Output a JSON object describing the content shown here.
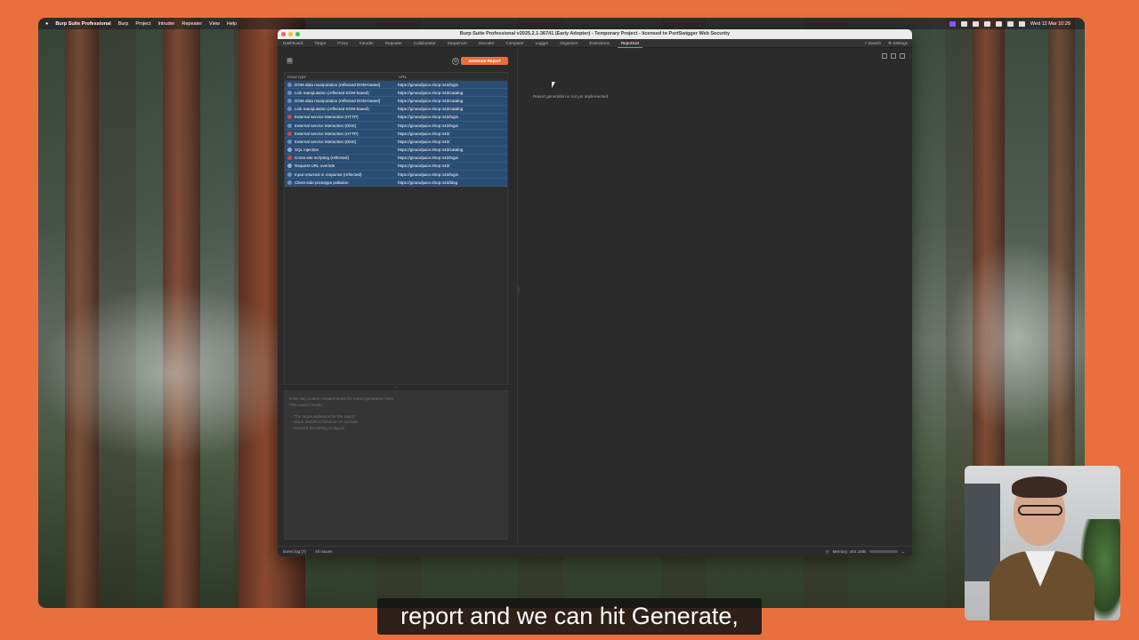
{
  "menubar": {
    "items": [
      "Burp Suite Professional",
      "Burp",
      "Project",
      "Intruder",
      "Repeater",
      "View",
      "Help"
    ],
    "clock": "Wed 12 Mar 10:29"
  },
  "window": {
    "title": "Burp Suite Professional v2025.2.1-36741 (Early Adopter) - Temporary Project - licensed to PortSwigger Web Security"
  },
  "tabs": [
    "Dashboard",
    "Target",
    "Proxy",
    "Intruder",
    "Repeater",
    "Collaborator",
    "Sequencer",
    "Decoder",
    "Comparer",
    "Logger",
    "Organizer",
    "Extensions",
    "ReportLM"
  ],
  "tabs_right": {
    "search": "Search",
    "settings": "Settings"
  },
  "toolbar": {
    "generate_label": "Generate Report"
  },
  "issues_table": {
    "headers": [
      "Issue type",
      "URL"
    ],
    "rows": [
      {
        "severity": "info",
        "type": "DOM data manipulation (reflected DOM-based)",
        "url": "https://ginandjuice.shop:443/login"
      },
      {
        "severity": "info",
        "type": "Link manipulation (reflected DOM-based)",
        "url": "https://ginandjuice.shop:443/catalog"
      },
      {
        "severity": "info",
        "type": "DOM data manipulation (reflected DOM-based)",
        "url": "https://ginandjuice.shop:443/catalog"
      },
      {
        "severity": "info",
        "type": "Link manipulation (reflected DOM-based)",
        "url": "https://ginandjuice.shop:443/catalog"
      },
      {
        "severity": "high",
        "type": "External service interaction (HTTP)",
        "url": "https://ginandjuice.shop:443/login"
      },
      {
        "severity": "info",
        "type": "External service interaction (DNS)",
        "url": "https://ginandjuice.shop:443/login"
      },
      {
        "severity": "high",
        "type": "External service interaction (HTTP)",
        "url": "https://ginandjuice.shop:443/"
      },
      {
        "severity": "info",
        "type": "External service interaction (DNS)",
        "url": "https://ginandjuice.shop:443/"
      },
      {
        "severity": "low",
        "type": "SQL injection",
        "url": "https://ginandjuice.shop:443/catalog"
      },
      {
        "severity": "high",
        "type": "Cross-site scripting (reflected)",
        "url": "https://ginandjuice.shop:443/login"
      },
      {
        "severity": "low",
        "type": "Request URL override",
        "url": "https://ginandjuice.shop:443/"
      },
      {
        "severity": "info",
        "type": "Input returned in response (reflected)",
        "url": "https://ginandjuice.shop:443/login"
      },
      {
        "severity": "info",
        "type": "Client-side prototype pollution",
        "url": "https://ginandjuice.shop:443/blog"
      }
    ]
  },
  "requirements": {
    "placeholder": "Enter any custom requirements for report generation here.\nThis could include:\n\n  - The target audience for the report\n  - Issue details to focus on or exclude\n  - Desired formatting or layout"
  },
  "report_panel": {
    "message": "Report generation is not yet implemented."
  },
  "statusbar": {
    "event_log": "Event log (7)",
    "all_issues": "All issues",
    "memory": "Memory: 404.1MB"
  },
  "subtitle": "report and we can hit Generate,",
  "colors": {
    "accent": "#e8703f",
    "selection": "#2b4d73"
  }
}
